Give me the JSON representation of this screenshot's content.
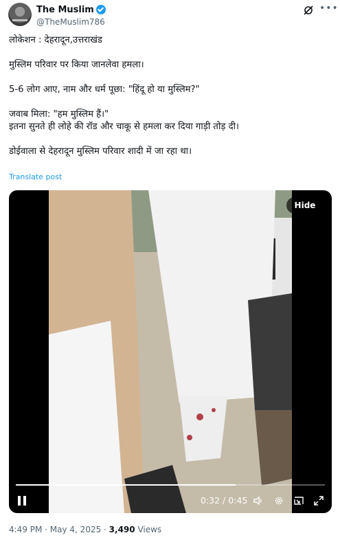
{
  "author": {
    "display_name": "The Muslim",
    "handle": "@TheMuslim786",
    "verified": true
  },
  "post": {
    "lines": [
      "लोकेशन : देहरादून,उत्तराखंड",
      "",
      "मुस्लिम परिवार पर किया जानलेवा हमला।",
      "",
      "5-6 लोग आए, नाम और धर्म पूछा: \"हिंदू हो या मुस्लिम?\"",
      "",
      "जवाब मिला: \"हम मुस्लिम हैं।\"",
      "इतना सुनते ही लोहे की रॉड और चाकू से हमला कर दिया गाड़ी तोड़ दी।",
      "",
      "डोईवाला से देहरादून मुस्लिम परिवार शादी में जा रहा था।"
    ],
    "translate_label": "Translate post"
  },
  "video": {
    "hide_label": "Hide",
    "time": "0:32 / 0:45",
    "progress_fraction": 0.711
  },
  "meta": {
    "time_date": "4:49 PM · May 4, 2025 · ",
    "views_count": "3,490",
    "views_label": " Views"
  },
  "colors": {
    "accent": "#1d9bf0",
    "text": "#0f1419",
    "secondary": "#536471"
  },
  "icons": [
    "verified-badge-icon",
    "grok-icon",
    "more-icon",
    "pause-icon",
    "volume-icon",
    "settings-icon",
    "picture-in-picture-icon",
    "fullscreen-icon"
  ]
}
